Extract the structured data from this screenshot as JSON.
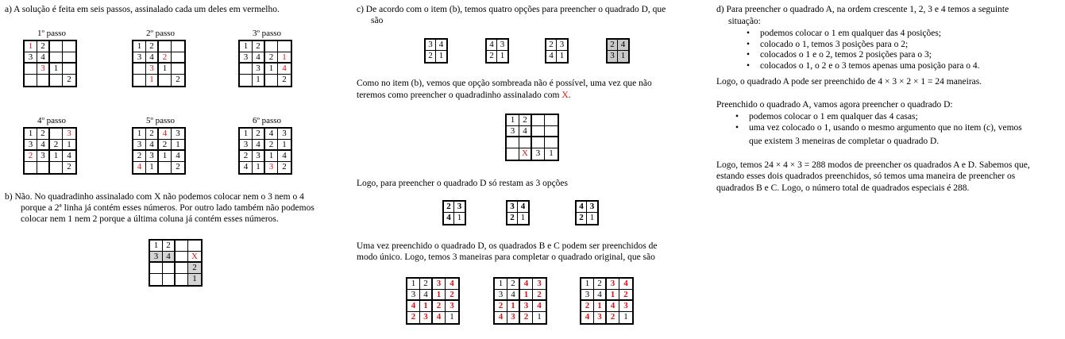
{
  "col_a": {
    "intro": "a) A solução é feita em seis passos, assinalado cada um deles em vermelho.",
    "steps": [
      {
        "label": "1º passo",
        "cells": [
          [
            "1",
            "2",
            "",
            ""
          ],
          [
            "3",
            "4",
            "",
            ""
          ],
          [
            "",
            "3",
            "1",
            ""
          ],
          [
            "",
            "",
            "",
            "2"
          ]
        ],
        "red": [
          [
            0,
            0
          ],
          [
            2,
            1
          ]
        ]
      },
      {
        "label": "2º passo",
        "cells": [
          [
            "1",
            "2",
            "",
            ""
          ],
          [
            "3",
            "4",
            "2",
            ""
          ],
          [
            "",
            "3",
            "1",
            ""
          ],
          [
            "",
            "1",
            "",
            "2"
          ]
        ],
        "red": [
          [
            1,
            2
          ],
          [
            2,
            1
          ],
          [
            3,
            1
          ]
        ]
      },
      {
        "label": "3º passo",
        "cells": [
          [
            "1",
            "2",
            "",
            ""
          ],
          [
            "3",
            "4",
            "2",
            "1"
          ],
          [
            "",
            "3",
            "1",
            "4"
          ],
          [
            "",
            "1",
            "",
            "2"
          ]
        ],
        "red": [
          [
            1,
            3
          ],
          [
            2,
            3
          ]
        ]
      },
      {
        "label": "4º passo",
        "cells": [
          [
            "1",
            "2",
            "",
            "3"
          ],
          [
            "3",
            "4",
            "2",
            "1"
          ],
          [
            "2",
            "3",
            "1",
            "4"
          ],
          [
            "",
            "",
            "",
            "2"
          ]
        ],
        "red": [
          [
            0,
            3
          ],
          [
            2,
            0
          ]
        ]
      },
      {
        "label": "5º passo",
        "cells": [
          [
            "1",
            "2",
            "4",
            "3"
          ],
          [
            "3",
            "4",
            "2",
            "1"
          ],
          [
            "2",
            "3",
            "1",
            "4"
          ],
          [
            "4",
            "1",
            "",
            "2"
          ]
        ],
        "red": [
          [
            0,
            2
          ],
          [
            3,
            0
          ]
        ]
      },
      {
        "label": "6º passo",
        "cells": [
          [
            "1",
            "2",
            "4",
            "3"
          ],
          [
            "3",
            "4",
            "2",
            "1"
          ],
          [
            "2",
            "3",
            "1",
            "4"
          ],
          [
            "4",
            "1",
            "3",
            "2"
          ]
        ],
        "red": [
          [
            3,
            2
          ]
        ]
      }
    ]
  },
  "col_b": {
    "lines": [
      "b)  Não. No quadradinho assinalado com X não podemos colocar nem o 3 nem o 4",
      "porque a 2ª linha já contém esses números.  Por outro lado também não podemos",
      "colocar nem 1 nem 2 porque a última coluna já contém esses números."
    ],
    "grid": [
      [
        "1",
        "2",
        "",
        ""
      ],
      [
        "3",
        "4",
        "",
        "X"
      ],
      [
        "",
        "",
        "",
        "2"
      ],
      [
        "",
        "",
        "",
        "1"
      ]
    ]
  },
  "col_c": {
    "intro_line1": "c)   De acordo com o item (b), temos quatro opções para preencher o quadrado D, que",
    "intro_line2": "são",
    "options": [
      [
        [
          "3",
          "4"
        ],
        [
          "2",
          "1"
        ]
      ],
      [
        [
          "4",
          "3"
        ],
        [
          "2",
          "1"
        ]
      ],
      [
        [
          "2",
          "3"
        ],
        [
          "4",
          "1"
        ]
      ],
      [
        [
          "2",
          "4"
        ],
        [
          "3",
          "1"
        ]
      ]
    ],
    "p2_line1": "Como no item (b), vemos que opção sombreada não é possível, uma vez que não",
    "p2_line2_pre": "teremos como preencher o quadradinho assinalado com ",
    "p2_line2_x": "X",
    "p2_line2_post": ".",
    "grid": [
      [
        "1",
        "2",
        "",
        ""
      ],
      [
        "3",
        "4",
        "",
        ""
      ],
      [
        "",
        "",
        "",
        ""
      ],
      [
        "",
        "X",
        "3",
        "1"
      ]
    ],
    "p3": "Logo, para preencher o quadrado D só restam as 3 opções",
    "remaining": [
      [
        [
          "2",
          "3"
        ],
        [
          "4",
          "1"
        ]
      ],
      [
        [
          "3",
          "4"
        ],
        [
          "2",
          "1"
        ]
      ],
      [
        [
          "4",
          "3"
        ],
        [
          "2",
          "1"
        ]
      ]
    ],
    "p4_line1": "Uma vez preenchido o quadrado D, os quadrados B e C podem ser preenchidos de",
    "p4_line2": "modo único.  Logo, temos 3 maneiras para completar o quadrado original, que são",
    "finals": [
      [
        [
          "1",
          "2",
          "3",
          "4"
        ],
        [
          "3",
          "4",
          "1",
          "2"
        ],
        [
          "4",
          "1",
          "2",
          "3"
        ],
        [
          "2",
          "3",
          "4",
          "1"
        ]
      ],
      [
        [
          "1",
          "2",
          "4",
          "3"
        ],
        [
          "3",
          "4",
          "1",
          "2"
        ],
        [
          "2",
          "1",
          "3",
          "4"
        ],
        [
          "4",
          "3",
          "2",
          "1"
        ]
      ],
      [
        [
          "1",
          "2",
          "3",
          "4"
        ],
        [
          "3",
          "4",
          "1",
          "2"
        ],
        [
          "2",
          "1",
          "4",
          "3"
        ],
        [
          "4",
          "3",
          "2",
          "1"
        ]
      ]
    ]
  },
  "col_d": {
    "intro_line1": "d)   Para preencher o quadrado A, na ordem crescente 1, 2, 3 e 4 temos a seguinte",
    "intro_line2": "situação:",
    "bullets_a": [
      "podemos colocar o 1 em qualquer das 4 posições;",
      "colocado o 1,  temos 3 posições para o 2;",
      "colocados  o 1 e o 2, temos 2 posições para o 3;",
      "colocados o 1, o 2 e o 3 temos apenas uma posição para o 4."
    ],
    "concl_a": "Logo, o quadrado A pode ser preenchido de  4 × 3 × 2 × 1 = 24  maneiras.",
    "p_d": "Preenchido o quadrado A, vamos agora preencher o quadrado D:",
    "bullets_d": [
      "podemos colocar o 1 em qualquer das 4 casas;",
      "uma vez colocado o 1,  usando o mesmo argumento que no item (c),  vemos"
    ],
    "bullet_d_cont": "que existem  3 meneiras de completar o quadrado D.",
    "final_lines": [
      "Logo, temos  24 × 4 × 3 = 288  modos de preencher os quadrados A e D. Sabemos que,",
      "estando esses dois quadrados preenchidos, só temos uma maneira de preencher os",
      "quadrados B e C. Logo, o número total de quadrados especiais é 288."
    ]
  }
}
